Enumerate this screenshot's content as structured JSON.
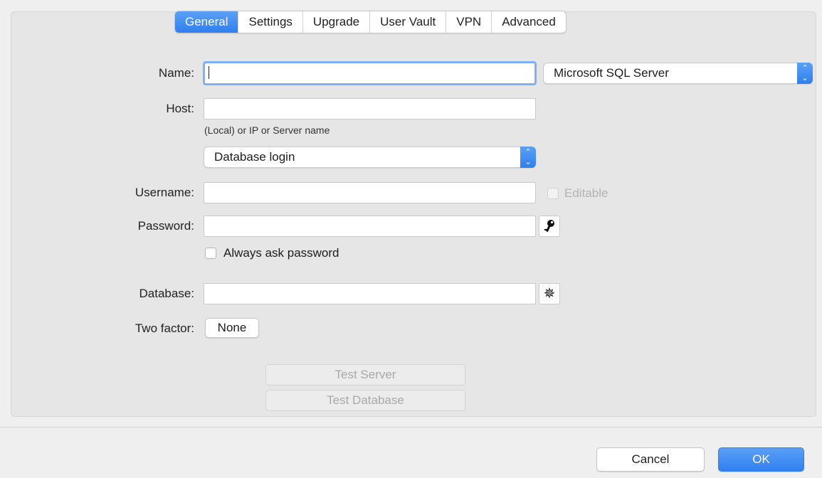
{
  "tabs": [
    {
      "label": "General",
      "active": true
    },
    {
      "label": "Settings",
      "active": false
    },
    {
      "label": "Upgrade",
      "active": false
    },
    {
      "label": "User Vault",
      "active": false
    },
    {
      "label": "VPN",
      "active": false
    },
    {
      "label": "Advanced",
      "active": false
    }
  ],
  "form": {
    "name_label": "Name:",
    "name_value": "",
    "server_type": "Microsoft SQL Server",
    "host_label": "Host:",
    "host_value": "",
    "host_hint": "(Local) or IP or Server name",
    "auth_mode": "Database login",
    "username_label": "Username:",
    "username_value": "",
    "editable_label": "Editable",
    "password_label": "Password:",
    "password_value": "",
    "always_ask_label": "Always ask password",
    "database_label": "Database:",
    "database_value": "",
    "two_factor_label": "Two factor:",
    "two_factor_value": "None",
    "test_server_label": "Test Server",
    "test_database_label": "Test Database"
  },
  "footer": {
    "cancel_label": "Cancel",
    "ok_label": "OK"
  },
  "icons": {
    "password": "key-icon",
    "database": "gear-icon",
    "select": "chevron-updown-icon"
  },
  "colors": {
    "accent": "#2f7ff0",
    "focus_ring": "#7db1f5"
  }
}
